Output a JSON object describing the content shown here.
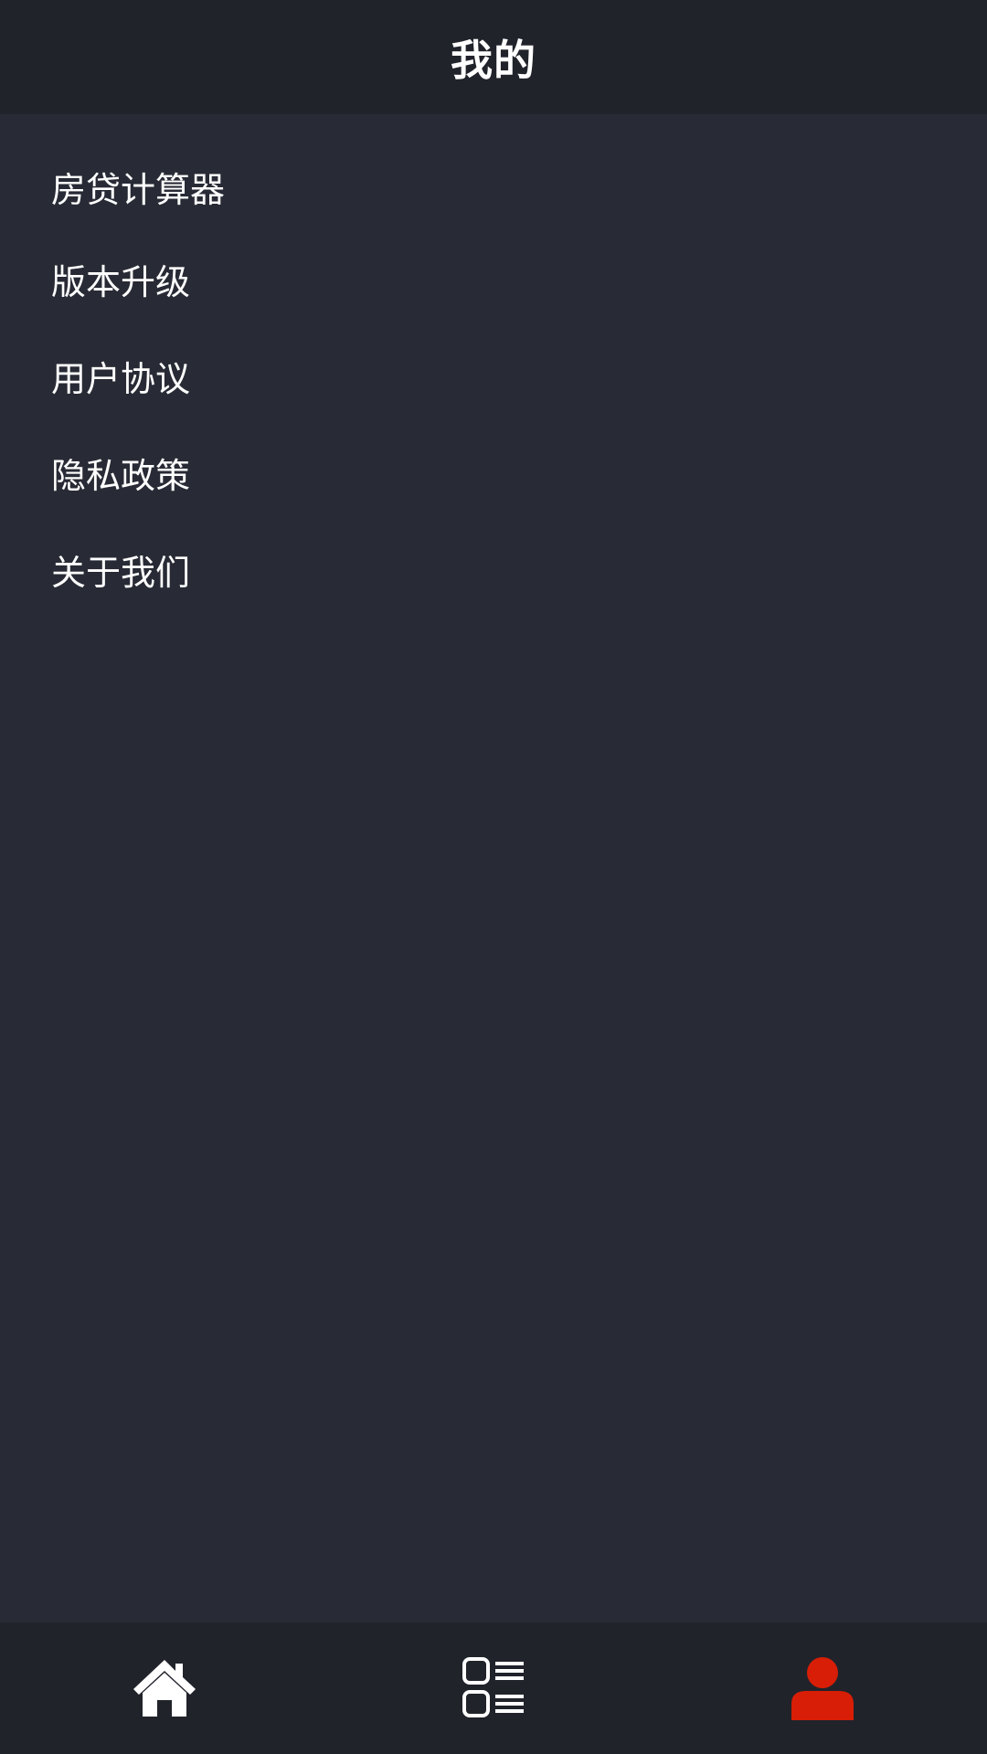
{
  "header": {
    "title": "我的"
  },
  "menu": {
    "items": [
      {
        "label": "房贷计算器"
      },
      {
        "label": "版本升级"
      },
      {
        "label": "用户协议"
      },
      {
        "label": "隐私政策"
      },
      {
        "label": "关于我们"
      }
    ]
  },
  "tabbar": {
    "tabs": [
      {
        "icon": "home-icon",
        "active": false
      },
      {
        "icon": "list-icon",
        "active": false
      },
      {
        "icon": "user-icon",
        "active": true
      }
    ],
    "active_color": "#d81e06",
    "inactive_color": "#ffffff"
  }
}
